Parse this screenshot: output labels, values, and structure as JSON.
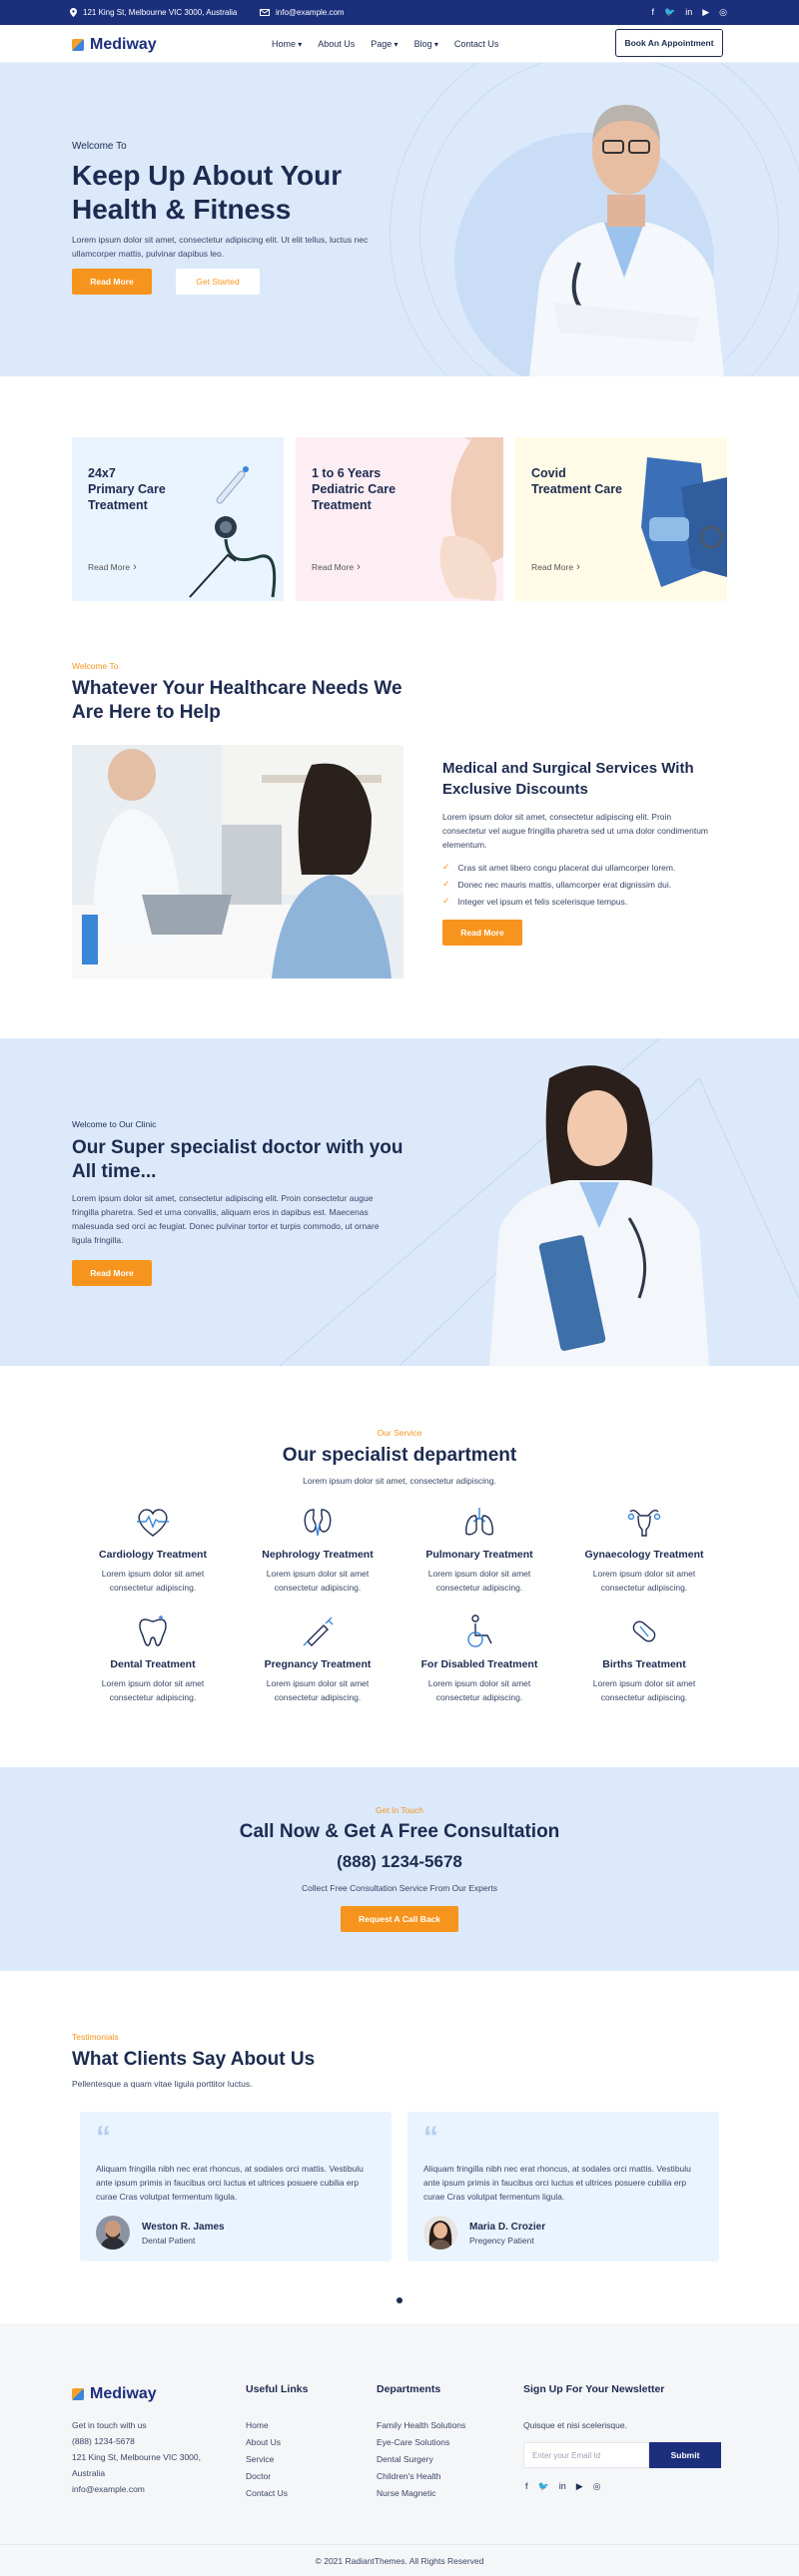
{
  "topbar": {
    "address": "121 King St, Melbourne VIC 3000, Australia",
    "email": "info@example.com",
    "social": [
      "facebook-icon",
      "twitter-icon",
      "linkedin-icon",
      "youtube-icon",
      "instagram-icon"
    ]
  },
  "brand": {
    "name": "Mediway"
  },
  "nav": {
    "items": [
      "Home",
      "About Us",
      "Page",
      "Blog",
      "Contact Us"
    ],
    "appointment_label": "Book An Appointment"
  },
  "hero": {
    "eyebrow": "Welcome To",
    "title_line1": "Keep Up About Your",
    "title_line2": "Health & Fitness",
    "text_line1": "Lorem ipsum dolor sit amet, consectetur adipiscing elit. Ut elit tellus, luctus nec",
    "text_line2": "ullamcorper mattis, pulvinar dapibus leo.",
    "primary_label": "Read More",
    "secondary_label": "Get Started"
  },
  "services": [
    {
      "line1": "24x7",
      "line2": "Primary Care",
      "line3": "Treatment",
      "link": "Read More",
      "bg": "#eaf4fe"
    },
    {
      "line1": "1 to 6 Years",
      "line2": "Pediatric Care",
      "line3": "Treatment",
      "link": "Read More",
      "bg": "#fdeef3"
    },
    {
      "line1": "Covid",
      "line2": "Treatment Care",
      "line3": "",
      "link": "Read More",
      "bg": "#fffbe6"
    }
  ],
  "help": {
    "eyebrow": "Welcome To",
    "title_line1": "Whatever Your Healthcare Needs We",
    "title_line2": "Are Here to Help",
    "sub_title_line1": "Medical and Surgical Services With",
    "sub_title_line2": "Exclusive Discounts",
    "text_line1": "Lorem ipsum dolor sit amet, consectetur adipiscing elit. Proin",
    "text_line2": "consectetur vel augue fringilla pharetra sed ut urna dolor condimentum",
    "text_line3": "elementum.",
    "checks": [
      "Cras sit amet libero congu placerat dui ullamcorper lorem.",
      "Donec nec mauris mattis, ullamcorper erat dignissim dui.",
      "Integer vel ipsum et felis scelerisque tempus."
    ],
    "button_label": "Read More"
  },
  "clinic": {
    "eyebrow": "Welcome to Our Clinic",
    "title_line1": "Our Super specialist doctor with you",
    "title_line2": "All time...",
    "text_line1": "Lorem ipsum dolor sit amet, consectetur adipiscing elit. Proin consectetur augue",
    "text_line2": "fringilla pharetra. Sed et urna convallis, aliquam eros in dapibus est. Maecenas",
    "text_line3": "malesuada sed orci ac feugiat. Donec pulvinar tortor et turpis commodo, ut ornare",
    "text_line4": "ligula fringilla.",
    "button_label": "Read More"
  },
  "departments": {
    "eyebrow": "Our Service",
    "title": "Our specialist department",
    "subtitle": "Lorem ipsum dolor sit amet, consectetur adipiscing.",
    "items": [
      {
        "name": "Cardiology Treatment",
        "icon": "heart-pulse-icon",
        "d1": "Lorem ipsum dolor sit amet",
        "d2": "consectetur adipiscing."
      },
      {
        "name": "Nephrology Treatment",
        "icon": "kidney-icon",
        "d1": "Lorem ipsum dolor sit amet",
        "d2": "consectetur adipiscing."
      },
      {
        "name": "Pulmonary Treatment",
        "icon": "lungs-icon",
        "d1": "Lorem ipsum dolor sit amet",
        "d2": "consectetur adipiscing."
      },
      {
        "name": "Gynaecology Treatment",
        "icon": "uterus-icon",
        "d1": "Lorem ipsum dolor sit amet",
        "d2": "consectetur adipiscing."
      },
      {
        "name": "Dental Treatment",
        "icon": "tooth-icon",
        "d1": "Lorem ipsum dolor sit amet",
        "d2": "consectetur adipiscing."
      },
      {
        "name": "Pregnancy Treatment",
        "icon": "syringe-icon",
        "d1": "Lorem ipsum dolor sit amet",
        "d2": "consectetur adipiscing."
      },
      {
        "name": "For Disabled Treatment",
        "icon": "wheelchair-icon",
        "d1": "Lorem ipsum dolor sit amet",
        "d2": "consectetur adipiscing."
      },
      {
        "name": "Births Treatment",
        "icon": "pill-icon",
        "d1": "Lorem ipsum dolor sit amet",
        "d2": "consectetur adipiscing."
      }
    ]
  },
  "consult": {
    "eyebrow": "Get In Touch",
    "title": "Call Now & Get A Free Consultation",
    "phone": "(888) 1234-5678",
    "subtitle": "Collect Free Consultation Service From Our Experts",
    "button_label": "Request A Call Back"
  },
  "testimonials": {
    "eyebrow": "Testimonials",
    "title": "What Clients Say About Us",
    "subtitle": "Pellentesque a quam vitae ligula porttitor luctus.",
    "items": [
      {
        "l1": "Aliquam fringilla nibh nec erat rhoncus, at sodales orci mattis. Vestibulu",
        "l2": "ante ipsum primis in faucibus orci luctus et ultrices posuere cubilia erp",
        "l3": "curae Cras volutpat fermentum ligula.",
        "name": "Weston R. James",
        "role": "Dental Patient"
      },
      {
        "l1": "Aliquam fringilla nibh nec erat rhoncus, at sodales orci mattis. Vestibulu",
        "l2": "ante ipsum primis in faucibus orci luctus et ultrices posuere cubilia erp",
        "l3": "curae Cras volutpat fermentum ligula.",
        "name": "Maria D. Crozier",
        "role": "Pregency Patient"
      }
    ]
  },
  "footer": {
    "contact_intro": "Get in touch with us",
    "phone": "(888) 1234-5678",
    "address_line1": "121 King St, Melbourne VIC 3000,",
    "address_line2": "Australia",
    "email": "info@example.com",
    "useful_title": "Useful Links",
    "useful_links": [
      "Home",
      "About Us",
      "Service",
      "Doctor",
      "Contact Us"
    ],
    "dept_title": "Departments",
    "dept_links": [
      "Family Health Solutions",
      "Eye-Care Solutions",
      "Dental Surgery",
      "Children's Health",
      "Nurse Magnetic"
    ],
    "newsletter_title": "Sign Up For Your Newsletter",
    "newsletter_text": "Quisque et nisi scelerisque.",
    "email_placeholder": "Enter your Email Id",
    "submit_label": "Submit",
    "copyright": "© 2021 RadiantThemes. All Rights Reserved"
  },
  "colors": {
    "navy": "#1b2f7c",
    "orange": "#f7941d",
    "light_blue": "#dbe9fb"
  }
}
